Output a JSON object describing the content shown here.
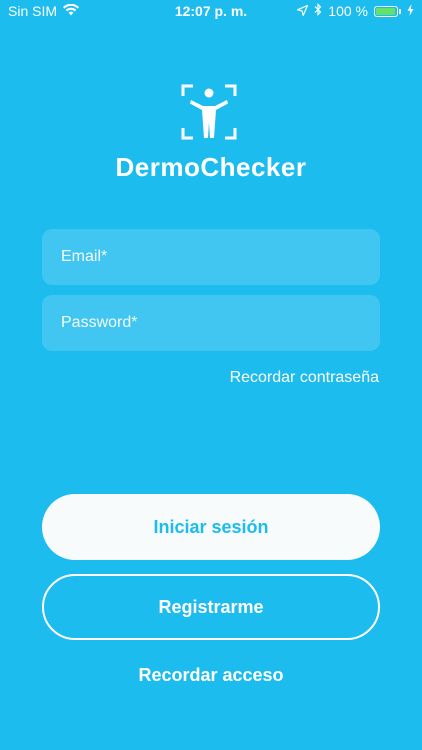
{
  "status_bar": {
    "carrier": "Sin SIM",
    "time": "12:07 p. m.",
    "battery_percent": "100 %",
    "battery_level": 1.0
  },
  "app": {
    "title": "DermoChecker",
    "logo_icon": "body-scan-icon"
  },
  "form": {
    "email_placeholder": "Email*",
    "password_placeholder": "Password*",
    "email_value": "",
    "password_value": ""
  },
  "links": {
    "recover_password": "Recordar contraseña",
    "recover_access": "Recordar acceso"
  },
  "buttons": {
    "login": "Iniciar sesión",
    "register": "Registrarme"
  },
  "colors": {
    "background": "#1cbcee",
    "accent": "#1cbcee",
    "battery": "#62e26a"
  }
}
